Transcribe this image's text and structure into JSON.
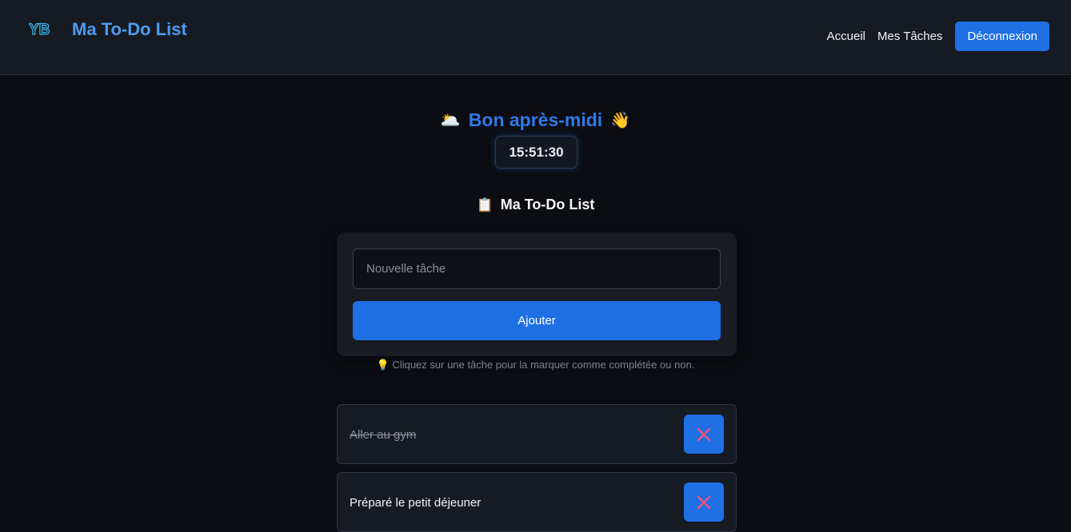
{
  "navbar": {
    "logo_text": "YB",
    "brand": "Ma To-Do List",
    "links": [
      "Accueil",
      "Mes Tâches"
    ],
    "logout_label": "Déconnexion"
  },
  "greeting": {
    "left_emoji": "🌥️",
    "text": "Bon après-midi",
    "right_emoji": "👋",
    "clock": "15:51:30"
  },
  "list": {
    "title_emoji": "📋",
    "title": "Ma To-Do List",
    "input_placeholder": "Nouvelle tâche",
    "add_label": "Ajouter",
    "hint_emoji": "💡",
    "hint": "Cliquez sur une tâche pour la marquer comme complétée ou non."
  },
  "tasks": [
    {
      "text": "Aller au gym",
      "completed": true
    },
    {
      "text": "Préparé le petit déjeuner",
      "completed": false
    }
  ],
  "colors": {
    "accent": "#1f6fe5",
    "delete_icon": "#f2567a"
  }
}
